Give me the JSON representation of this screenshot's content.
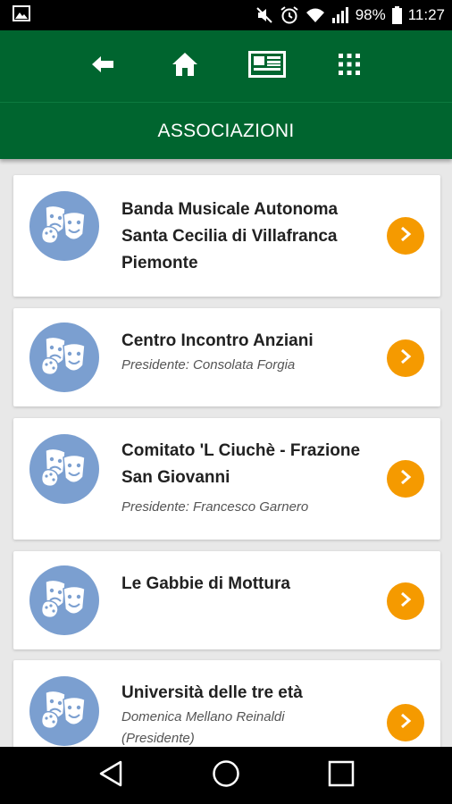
{
  "status_bar": {
    "battery": "98%",
    "time": "11:27"
  },
  "toolbar": {
    "icons": [
      "back-arrow-icon",
      "home-icon",
      "newspaper-icon",
      "apps-grid-icon"
    ]
  },
  "header": {
    "title": "ASSOCIAZIONI"
  },
  "associations": [
    {
      "name_lines": [
        "Banda Musicale Autonoma",
        "Santa Cecilia di Villafranca",
        "Piemonte"
      ],
      "subtitle": ""
    },
    {
      "name_lines": [
        "Centro Incontro Anziani"
      ],
      "subtitle": "Presidente: Consolata Forgia"
    },
    {
      "name_lines": [
        "Comitato 'L Ciuchè - Frazione",
        "San Giovanni"
      ],
      "subtitle": "Presidente: Francesco Garnero"
    },
    {
      "name_lines": [
        "Le Gabbie di Mottura"
      ],
      "subtitle": ""
    },
    {
      "name_lines": [
        "Università delle tre età"
      ],
      "subtitle": "Domenica Mellano Reinaldi",
      "subtitle2": "(Presidente)"
    }
  ],
  "colors": {
    "brand_green": "#00652f",
    "accent_orange": "#f59a00",
    "avatar_blue": "#7b9fd0"
  }
}
